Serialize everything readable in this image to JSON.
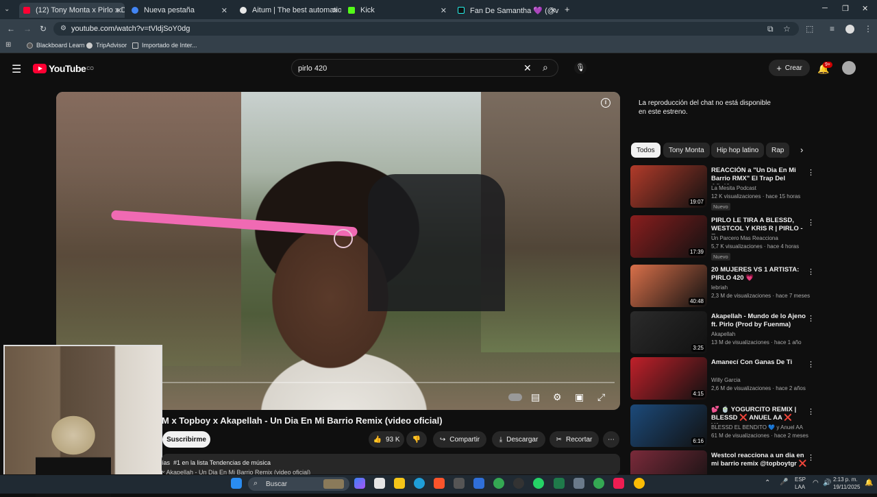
{
  "browser": {
    "tabs": [
      {
        "label": "(12) Tony Monta x Pirlo x D",
        "active": true,
        "color": "#ff0033"
      },
      {
        "label": "Nueva pestaña",
        "active": false,
        "color": "#4285f4"
      },
      {
        "label": "Aitum | The best automation to",
        "active": false,
        "color": "#e8e8e8"
      },
      {
        "label": "Kick",
        "active": false,
        "color": "#53fc18"
      },
      {
        "label": "Fan De Samantha 💜 (@vsp.sa",
        "active": false,
        "color": "#111111"
      }
    ],
    "new_tab": "+",
    "url": "youtube.com/watch?v=tVldjSoY0dg",
    "bookmarks": [
      {
        "label": "Blackboard Learn"
      },
      {
        "label": "TripAdvisor"
      },
      {
        "label": "Importado de Inter..."
      }
    ]
  },
  "youtube": {
    "logo": "YouTube",
    "logo_country": "CO",
    "search_query": "pirlo 420",
    "create_label": "Crear",
    "notif_count": "9+",
    "video_title": "M x Topboy x Akapellah - Un Dia En Mi Barrio Remix (video oficial)",
    "subscribe_label": "Suscribirme",
    "likes": "93 K",
    "share_label": "Compartir",
    "download_label": "Descargar",
    "clip_label": "Recortar",
    "desc_line1_a": "ías",
    "desc_line1_b": "#1 en la lista Tendencias de música",
    "desc_line2": "x Akapellah - Un Dia En Mi Barrio Remix (video oficial)",
    "chat_note": "La reproducción del chat no está disponible en este estreno.",
    "chips": [
      "Todos",
      "Tony Monta",
      "Hip hop latino",
      "Rap"
    ],
    "recommendations": [
      {
        "title": "REACCIÓN a \"Un Dia En Mi Barrio RMX\" El Trap Del Año!?...",
        "channel": "La Mesita Podcast",
        "meta": "12 K visualizaciones · hace 15 horas",
        "badge": "Nuevo",
        "duration": "19:07",
        "color": "#b23b2a"
      },
      {
        "title": "PIRLO LE TIRA A BLESSD, WESTCOL Y KRIS R | PIRLO - E...",
        "channel": "Un Parcero Mas Reacciona",
        "meta": "5,7 K visualizaciones · hace 4 horas",
        "badge": "Nuevo",
        "duration": "17:39",
        "color": "#8a1e1e"
      },
      {
        "title": "20 MUJERES VS 1 ARTISTA: PIRLO 420 💗",
        "channel": "lebriah",
        "meta": "2,3 M de visualizaciones · hace 7 meses",
        "badge": "",
        "duration": "40:48",
        "color": "#d9704a"
      },
      {
        "title": "Akapellah - Mundo de lo Ajeno ft. Pirlo (Prod by Fuenma)",
        "channel": "Akapellah",
        "meta": "13 M de visualizaciones · hace 1 año",
        "badge": "",
        "duration": "3:25",
        "color": "#2b2b2b"
      },
      {
        "title": "Amanecí Con Ganas De Ti",
        "channel": "Willy Garcia",
        "meta": "2,6 M de visualizaciones · hace 2 años",
        "badge": "",
        "duration": "4:15",
        "color": "#c0202a"
      },
      {
        "title": "💕 🍵 YOGURCITO REMIX | BLESSD ❌ ANUEL AA ❌ YA...",
        "channel": "BLESSD EL BENDITO 💙 y Anuel AA",
        "meta": "61 M de visualizaciones · hace 2 meses",
        "badge": "",
        "duration": "6:16",
        "color": "#1c4a7a"
      },
      {
        "title": "Westcol reacciona a un dia en mi barrio remix @topboytgr ❌ ...",
        "channel": "",
        "meta": "",
        "badge": "",
        "duration": "",
        "color": "#7a2a3a"
      }
    ]
  },
  "taskbar": {
    "search_label": "Buscar",
    "lang": "ESP",
    "lang2": "LAA",
    "time": "2:13 p. m.",
    "date": "19/11/2025"
  }
}
